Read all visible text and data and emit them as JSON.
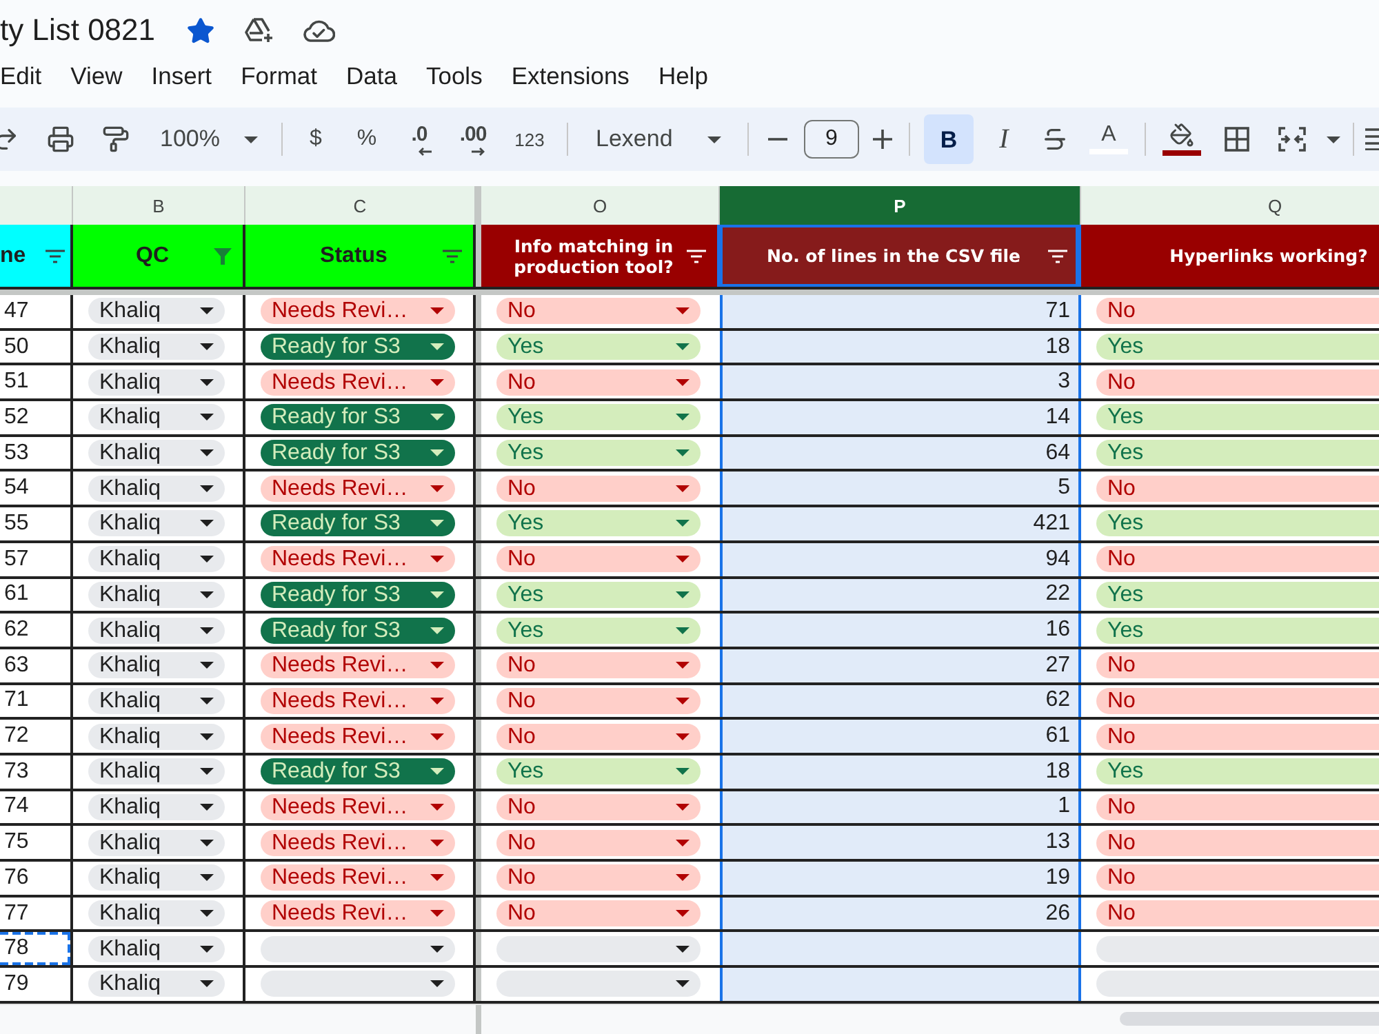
{
  "document": {
    "title": "ty List 0821",
    "starred": true
  },
  "menu": [
    "Edit",
    "View",
    "Insert",
    "Format",
    "Data",
    "Tools",
    "Extensions",
    "Help"
  ],
  "toolbar": {
    "zoom": "100%",
    "number_formats": [
      {
        "label": "$",
        "kind": "plain"
      },
      {
        "label": "%",
        "kind": "plain"
      },
      {
        "label": ".0",
        "kind": "decrease"
      },
      {
        "label": ".00",
        "kind": "increase"
      },
      {
        "label": "123",
        "kind": "plain"
      }
    ],
    "font": "Lexend",
    "font_size": "9",
    "text_styles": [
      {
        "label": "B",
        "kind": "bold",
        "selected": true
      },
      {
        "label": "I",
        "kind": "italic",
        "selected": false
      }
    ],
    "text_color": {
      "label": "A",
      "color": "#ffffff"
    },
    "fill_color": {
      "color": "#990000"
    }
  },
  "sheet": {
    "columns": [
      {
        "header": "ne",
        "color": "#00ffff",
        "filter": true,
        "filter_active": false,
        "selected": false
      },
      {
        "letter": "B",
        "header": "QC",
        "color": "#00ff00",
        "filter": true,
        "filter_active": true,
        "selected": false
      },
      {
        "letter": "C",
        "header": "Status",
        "color": "#00ff00",
        "filter": true,
        "filter_active": false,
        "selected": false
      },
      {
        "letter": "O",
        "header": "Info matching in production tool?",
        "color": "#990000",
        "filter": true,
        "filter_active": false,
        "selected": false
      },
      {
        "letter": "P",
        "header": "No. of lines in the CSV file",
        "color": "#861b1b",
        "filter": true,
        "filter_active": false,
        "selected": true
      },
      {
        "letter": "Q",
        "header": "Hyperlinks working?",
        "color": "#990000",
        "selected": false
      }
    ],
    "rows": [
      {
        "id": "47",
        "qc": "Khaliq",
        "status": {
          "text": "Needs Revi…",
          "kind": "review"
        },
        "info": {
          "text": "No",
          "kind": "no"
        },
        "lines": "71",
        "links": {
          "text": "No",
          "kind": "no"
        },
        "marked": false
      },
      {
        "id": "50",
        "qc": "Khaliq",
        "status": {
          "text": "Ready for S3",
          "kind": "ready"
        },
        "info": {
          "text": "Yes",
          "kind": "yes"
        },
        "lines": "18",
        "links": {
          "text": "Yes",
          "kind": "yes"
        },
        "marked": false
      },
      {
        "id": "51",
        "qc": "Khaliq",
        "status": {
          "text": "Needs Revi…",
          "kind": "review"
        },
        "info": {
          "text": "No",
          "kind": "no"
        },
        "lines": "3",
        "links": {
          "text": "No",
          "kind": "no"
        },
        "marked": false
      },
      {
        "id": "52",
        "qc": "Khaliq",
        "status": {
          "text": "Ready for S3",
          "kind": "ready"
        },
        "info": {
          "text": "Yes",
          "kind": "yes"
        },
        "lines": "14",
        "links": {
          "text": "Yes",
          "kind": "yes"
        },
        "marked": false
      },
      {
        "id": "53",
        "qc": "Khaliq",
        "status": {
          "text": "Ready for S3",
          "kind": "ready"
        },
        "info": {
          "text": "Yes",
          "kind": "yes"
        },
        "lines": "64",
        "links": {
          "text": "Yes",
          "kind": "yes"
        },
        "marked": false
      },
      {
        "id": "54",
        "qc": "Khaliq",
        "status": {
          "text": "Needs Revi…",
          "kind": "review"
        },
        "info": {
          "text": "No",
          "kind": "no"
        },
        "lines": "5",
        "links": {
          "text": "No",
          "kind": "no"
        },
        "marked": false
      },
      {
        "id": "55",
        "qc": "Khaliq",
        "status": {
          "text": "Ready for S3",
          "kind": "ready"
        },
        "info": {
          "text": "Yes",
          "kind": "yes"
        },
        "lines": "421",
        "links": {
          "text": "Yes",
          "kind": "yes"
        },
        "marked": false
      },
      {
        "id": "57",
        "qc": "Khaliq",
        "status": {
          "text": "Needs Revi…",
          "kind": "review"
        },
        "info": {
          "text": "No",
          "kind": "no"
        },
        "lines": "94",
        "links": {
          "text": "No",
          "kind": "no"
        },
        "marked": false
      },
      {
        "id": "61",
        "qc": "Khaliq",
        "status": {
          "text": "Ready for S3",
          "kind": "ready"
        },
        "info": {
          "text": "Yes",
          "kind": "yes"
        },
        "lines": "22",
        "links": {
          "text": "Yes",
          "kind": "yes"
        },
        "marked": false
      },
      {
        "id": "62",
        "qc": "Khaliq",
        "status": {
          "text": "Ready for S3",
          "kind": "ready"
        },
        "info": {
          "text": "Yes",
          "kind": "yes"
        },
        "lines": "16",
        "links": {
          "text": "Yes",
          "kind": "yes"
        },
        "marked": false
      },
      {
        "id": "63",
        "qc": "Khaliq",
        "status": {
          "text": "Needs Revi…",
          "kind": "review"
        },
        "info": {
          "text": "No",
          "kind": "no"
        },
        "lines": "27",
        "links": {
          "text": "No",
          "kind": "no"
        },
        "marked": false
      },
      {
        "id": "71",
        "qc": "Khaliq",
        "status": {
          "text": "Needs Revi…",
          "kind": "review"
        },
        "info": {
          "text": "No",
          "kind": "no"
        },
        "lines": "62",
        "links": {
          "text": "No",
          "kind": "no"
        },
        "marked": false
      },
      {
        "id": "72",
        "qc": "Khaliq",
        "status": {
          "text": "Needs Revi…",
          "kind": "review"
        },
        "info": {
          "text": "No",
          "kind": "no"
        },
        "lines": "61",
        "links": {
          "text": "No",
          "kind": "no"
        },
        "marked": false
      },
      {
        "id": "73",
        "qc": "Khaliq",
        "status": {
          "text": "Ready for S3",
          "kind": "ready"
        },
        "info": {
          "text": "Yes",
          "kind": "yes"
        },
        "lines": "18",
        "links": {
          "text": "Yes",
          "kind": "yes"
        },
        "marked": false
      },
      {
        "id": "74",
        "qc": "Khaliq",
        "status": {
          "text": "Needs Revi…",
          "kind": "review"
        },
        "info": {
          "text": "No",
          "kind": "no"
        },
        "lines": "1",
        "links": {
          "text": "No",
          "kind": "no"
        },
        "marked": false
      },
      {
        "id": "75",
        "qc": "Khaliq",
        "status": {
          "text": "Needs Revi…",
          "kind": "review"
        },
        "info": {
          "text": "No",
          "kind": "no"
        },
        "lines": "13",
        "links": {
          "text": "No",
          "kind": "no"
        },
        "marked": false
      },
      {
        "id": "76",
        "qc": "Khaliq",
        "status": {
          "text": "Needs Revi…",
          "kind": "review"
        },
        "info": {
          "text": "No",
          "kind": "no"
        },
        "lines": "19",
        "links": {
          "text": "No",
          "kind": "no"
        },
        "marked": false
      },
      {
        "id": "77",
        "qc": "Khaliq",
        "status": {
          "text": "Needs Revi…",
          "kind": "review"
        },
        "info": {
          "text": "No",
          "kind": "no"
        },
        "lines": "26",
        "links": {
          "text": "No",
          "kind": "no"
        },
        "marked": false
      },
      {
        "id": "78",
        "qc": "Khaliq",
        "status": {
          "kind": "empty"
        },
        "info": {
          "kind": "empty"
        },
        "links": {
          "kind": "empty"
        },
        "marked": true
      },
      {
        "id": "79",
        "qc": "Khaliq",
        "status": {
          "kind": "empty"
        },
        "info": {
          "kind": "empty"
        },
        "links": {
          "kind": "empty"
        },
        "marked": false
      }
    ]
  }
}
